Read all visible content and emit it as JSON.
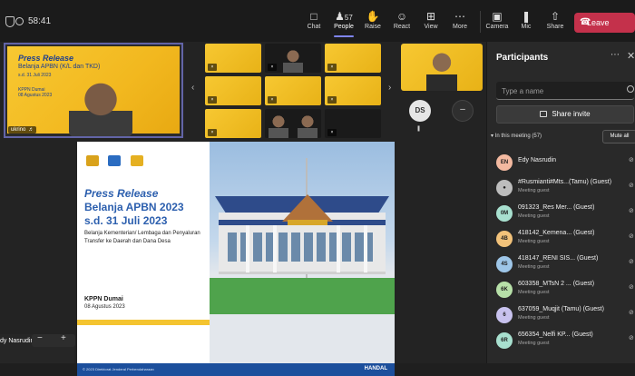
{
  "topbar": {
    "timer": "58:41",
    "buttons": [
      {
        "label": "Chat",
        "icon": "chat-icon"
      },
      {
        "label": "People",
        "icon": "people-icon",
        "count": "57"
      },
      {
        "label": "Raise",
        "icon": "raise-hand-icon"
      },
      {
        "label": "React",
        "icon": "react-icon"
      },
      {
        "label": "View",
        "icon": "view-icon"
      },
      {
        "label": "More",
        "icon": "more-icon"
      },
      {
        "label": "Camera",
        "icon": "camera-icon"
      },
      {
        "label": "Mic",
        "icon": "mic-off-icon"
      },
      {
        "label": "Share",
        "icon": "share-icon"
      }
    ],
    "leave_label": "Leave"
  },
  "stage": {
    "main_tile_label": "ukrino",
    "thumb": {
      "title": "Press Release",
      "subtitle": "Belanja APBN (K/L dan TKD)",
      "date": "s.d. 31 Juli 2023",
      "office": "KPPN Dumai",
      "office_date": "08 Agustus 2023"
    },
    "avatar_initials": "DS",
    "bottom_name": "dy Nasrudin",
    "zoom_minus": "−",
    "zoom_plus": "+"
  },
  "slide": {
    "title": "Press Release",
    "subtitle": "Belanja APBN 2023",
    "date": "s.d. 31 Juli 2023",
    "description": "Belanja Kementerian/ Lembaga dan Penyaluran Transfer ke Daerah dan Dana Desa",
    "office": "KPPN Dumai",
    "office_date": "08 Agustus 2023",
    "footer_left": "© 2023 Direktorat Jenderal Perbendaharaan",
    "footer_right": "HANDAL"
  },
  "panel": {
    "title": "Participants",
    "search_placeholder": "Type a name",
    "share_invite": "Share invite",
    "section_label": "In this meeting (57)",
    "mute_all": "Mute all",
    "participants": [
      {
        "initials": "EN",
        "name": "Edy Nasrudin",
        "role": "",
        "color": "#f3b9a0"
      },
      {
        "initials": "",
        "name": "#Rusmianti#Mts...(Tamu) (Guest)",
        "role": "Meeting guest",
        "color": "#bdbdbd"
      },
      {
        "initials": "0M",
        "name": "091323_Res Mer...  (Guest)",
        "role": "Meeting guest",
        "color": "#a8e0cf"
      },
      {
        "initials": "4B",
        "name": "418142_Kemena...  (Guest)",
        "role": "Meeting guest",
        "color": "#f2c27a"
      },
      {
        "initials": "4S",
        "name": "418147_RENI SIS...  (Guest)",
        "role": "Meeting guest",
        "color": "#9ec6e8"
      },
      {
        "initials": "6K",
        "name": "603358_MTsN 2 ...  (Guest)",
        "role": "Meeting guest",
        "color": "#b7e0a8"
      },
      {
        "initials": "6",
        "name": "637059_Muqjit (Tamu) (Guest)",
        "role": "Meeting guest",
        "color": "#c8c2ee"
      },
      {
        "initials": "6R",
        "name": "656354_Nelfi KP...  (Guest)",
        "role": "Meeting guest",
        "color": "#a8e0cf"
      }
    ]
  },
  "colors": {
    "accent": "#6264a7",
    "leave": "#c4314b",
    "slide_blue": "#2c5fae",
    "slide_yellow": "#f4c430"
  }
}
